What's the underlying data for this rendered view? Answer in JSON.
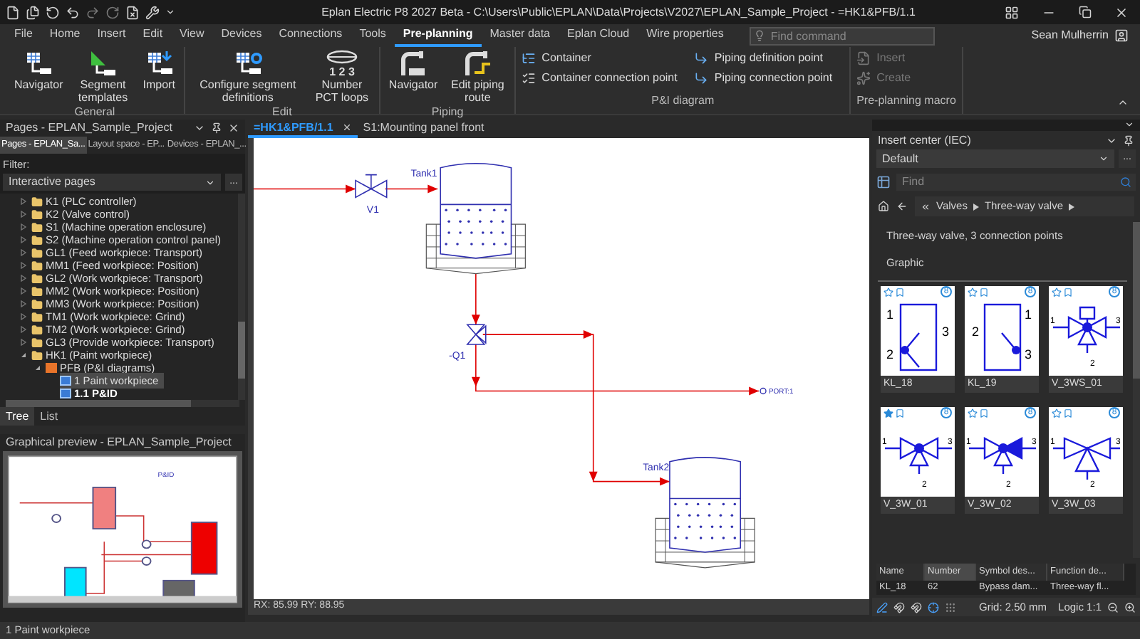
{
  "title_bar": {
    "title": "Eplan Electric P8 2027 Beta - C:\\Users\\Public\\EPLAN\\Data\\Projects\\V2027\\EPLAN_Sample_Project - =HK1&PFB/1.1"
  },
  "menu_tabs": [
    {
      "label": "File",
      "selected": false
    },
    {
      "label": "Home",
      "selected": false
    },
    {
      "label": "Insert",
      "selected": false
    },
    {
      "label": "Edit",
      "selected": false
    },
    {
      "label": "View",
      "selected": false
    },
    {
      "label": "Devices",
      "selected": false
    },
    {
      "label": "Connections",
      "selected": false
    },
    {
      "label": "Tools",
      "selected": false
    },
    {
      "label": "Pre-planning",
      "selected": true
    },
    {
      "label": "Master data",
      "selected": false
    },
    {
      "label": "Eplan Cloud",
      "selected": false
    },
    {
      "label": "Wire properties",
      "selected": false
    }
  ],
  "search": {
    "placeholder": "Find command"
  },
  "user": {
    "name": "Sean Mulherrin"
  },
  "ribbon_groups": [
    {
      "label": "General",
      "items": [
        {
          "label": "Navigator",
          "kind": "large",
          "disabled": false
        },
        {
          "label": "Segment templates",
          "kind": "large",
          "disabled": false
        },
        {
          "label": "Import",
          "kind": "large",
          "disabled": false
        }
      ]
    },
    {
      "label": "Edit",
      "items": [
        {
          "label": "Configure segment definitions",
          "kind": "large",
          "disabled": false
        },
        {
          "label": "Number PCT loops",
          "icon_text": "1 2 3",
          "kind": "large",
          "disabled": false
        }
      ]
    },
    {
      "label": "Piping",
      "items": [
        {
          "label": "Navigator",
          "kind": "large",
          "disabled": false
        },
        {
          "label": "Edit piping route",
          "kind": "large",
          "disabled": false
        }
      ]
    },
    {
      "label": "P&I diagram",
      "items": [
        {
          "label": "Container",
          "kind": "small",
          "disabled": false
        },
        {
          "label": "Container connection point",
          "kind": "small",
          "disabled": false
        },
        {
          "label": "Piping definition point",
          "kind": "small",
          "disabled": false
        },
        {
          "label": "Piping connection point",
          "kind": "small",
          "disabled": false
        }
      ]
    },
    {
      "label": "Pre-planning macro",
      "items": [
        {
          "label": "Insert",
          "kind": "small",
          "disabled": true
        },
        {
          "label": "Create",
          "kind": "small",
          "disabled": true
        }
      ]
    }
  ],
  "pages_panel": {
    "title": "Pages - EPLAN_Sample_Project",
    "tabs": [
      {
        "label": "Pages - EPLAN_Sa...",
        "selected": true
      },
      {
        "label": "Layout space - EP...",
        "selected": false
      },
      {
        "label": "Devices - EPLAN_...",
        "selected": false
      }
    ],
    "filter_label": "Filter:",
    "filter_value": "Interactive pages",
    "filter_more": "...",
    "tree": [
      {
        "label": "K1 (PLC controller)",
        "expanded": false,
        "selected": false
      },
      {
        "label": "K2 (Valve control)",
        "expanded": false,
        "selected": false
      },
      {
        "label": "S1 (Machine operation enclosure)",
        "expanded": false,
        "selected": false
      },
      {
        "label": "S2 (Machine operation control panel)",
        "expanded": false,
        "selected": false
      },
      {
        "label": "GL1 (Feed workpiece: Transport)",
        "expanded": false,
        "selected": false
      },
      {
        "label": "MM1 (Feed workpiece: Position)",
        "expanded": false,
        "selected": false
      },
      {
        "label": "GL2 (Work workpiece: Transport)",
        "expanded": false,
        "selected": false
      },
      {
        "label": "MM2 (Work workpiece: Position)",
        "expanded": false,
        "selected": false
      },
      {
        "label": "MM3 (Work workpiece: Position)",
        "expanded": false,
        "selected": false
      },
      {
        "label": "TM1 (Work workpiece: Grind)",
        "expanded": false,
        "selected": false
      },
      {
        "label": "TM2 (Work workpiece: Grind)",
        "expanded": false,
        "selected": false
      },
      {
        "label": "GL3 (Provide workpiece: Transport)",
        "expanded": false,
        "selected": false
      },
      {
        "label": "HK1 (Paint workpiece)",
        "expanded": true,
        "selected": false,
        "children": [
          {
            "label": "PFB (P&I diagrams)",
            "expanded": true,
            "selected": false,
            "children": [
              {
                "label": "1 Paint workpiece",
                "selected": true,
                "open": false
              },
              {
                "label": "1.1 P&ID",
                "selected": false,
                "open": true
              }
            ]
          }
        ]
      }
    ],
    "bottom_tabs": [
      {
        "label": "Tree",
        "selected": true
      },
      {
        "label": "List",
        "selected": false
      }
    ]
  },
  "preview": {
    "title": "Graphical preview - EPLAN_Sample_Project",
    "sheet_title": "P&ID"
  },
  "document_tabs": [
    {
      "label": "=HK1&PFB/1.1",
      "selected": true,
      "closable": true
    },
    {
      "label": "S1:Mounting panel front",
      "selected": false,
      "closable": false
    }
  ],
  "diagram": {
    "labels": [
      {
        "kind": "valve1",
        "text": "V1"
      },
      {
        "kind": "tank1",
        "text": "Tank1"
      },
      {
        "kind": "valve2",
        "text": "-Q1"
      },
      {
        "kind": "port",
        "text": "PORT:1"
      },
      {
        "kind": "tank2",
        "text": "Tank2"
      }
    ]
  },
  "coordinates": "RX: 85.99 RY: 88.95",
  "insert_center": {
    "title": "Insert center (IEC)",
    "view": "Default",
    "view_more": "...",
    "find_placeholder": "Find",
    "breadcrumb": [
      "Valves",
      "Three-way valve"
    ],
    "description": "Three-way valve, 3 connection points",
    "section": "Graphic",
    "symbols": [
      {
        "name": "KL_18",
        "kind": "bracket-left",
        "favorite": false,
        "badge": "8",
        "pins": [
          "1",
          "2",
          "3"
        ]
      },
      {
        "name": "KL_19",
        "kind": "bracket-right",
        "favorite": false,
        "badge": "8",
        "pins": [
          "1",
          "2",
          "3"
        ]
      },
      {
        "name": "V_3WS_01",
        "kind": "valve-square",
        "favorite": false,
        "badge": "8",
        "pins": [
          "1",
          "2",
          "3"
        ]
      },
      {
        "name": "V_3W_01",
        "kind": "valve-dot",
        "favorite": true,
        "badge": "8",
        "pins": [
          "1",
          "2",
          "3"
        ]
      },
      {
        "name": "V_3W_02",
        "kind": "valve-filled",
        "favorite": false,
        "badge": "8",
        "pins": [
          "1",
          "2",
          "3"
        ]
      },
      {
        "name": "V_3W_03",
        "kind": "valve-plain",
        "favorite": false,
        "badge": "8",
        "pins": [
          "1",
          "2",
          "3"
        ]
      }
    ],
    "table": {
      "columns": [
        {
          "label": "Name",
          "selected": false
        },
        {
          "label": "Number",
          "selected": true
        },
        {
          "label": "Symbol des...",
          "selected": false
        },
        {
          "label": "Function de...",
          "selected": false
        }
      ],
      "rows": [
        [
          "KL_18",
          "62",
          "Bypass dam...",
          "Three-way fl..."
        ]
      ]
    },
    "grid": "Grid: 2.50 mm",
    "logic": "Logic 1:1"
  },
  "status_bar": "1 Paint workpiece"
}
